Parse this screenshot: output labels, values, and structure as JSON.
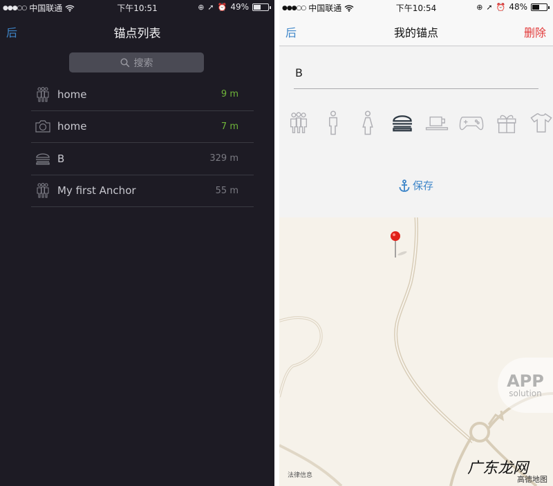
{
  "left": {
    "status": {
      "carrier": "中国联通",
      "time": "下午10:51",
      "battery": "49%",
      "battery_level": 0.49
    },
    "nav": {
      "back": "后",
      "title": "锚点列表"
    },
    "search": {
      "placeholder": "搜索"
    },
    "anchors": [
      {
        "icon": "group-icon",
        "name": "home",
        "distance": "9 m",
        "near": true
      },
      {
        "icon": "camera-icon",
        "name": "home",
        "distance": "7 m",
        "near": true
      },
      {
        "icon": "burger-icon",
        "name": "B",
        "distance": "329 m",
        "near": false
      },
      {
        "icon": "group-icon",
        "name": "My first Anchor",
        "distance": "55 m",
        "near": false
      }
    ],
    "colors": {
      "background": "#1d1b24",
      "accent": "#3e86c9",
      "near": "#6fb53a"
    }
  },
  "right": {
    "status": {
      "carrier": "中国联通",
      "time": "下午10:54",
      "battery": "48%",
      "battery_level": 0.48
    },
    "nav": {
      "back": "后",
      "title": "我的锚点",
      "delete": "删除"
    },
    "name_field": {
      "value": "B"
    },
    "icon_options": [
      {
        "icon": "group-icon",
        "selected": false
      },
      {
        "icon": "man-icon",
        "selected": false
      },
      {
        "icon": "woman-icon",
        "selected": false
      },
      {
        "icon": "burger-icon",
        "selected": true
      },
      {
        "icon": "coffee-cup-icon",
        "selected": false
      },
      {
        "icon": "gamepad-icon",
        "selected": false
      },
      {
        "icon": "gift-icon",
        "selected": false
      },
      {
        "icon": "tshirt-icon",
        "selected": false
      }
    ],
    "save": {
      "label": "保存"
    },
    "map": {
      "legal": "法律信息",
      "pin_color": "#e0221a"
    },
    "colors": {
      "delete": "#e23a3a",
      "accent": "#3e86c9"
    }
  },
  "watermarks": {
    "app_big": "APP",
    "app_small": "solution",
    "gdl": "广东龙网",
    "gdl_sub": "高德地图"
  }
}
